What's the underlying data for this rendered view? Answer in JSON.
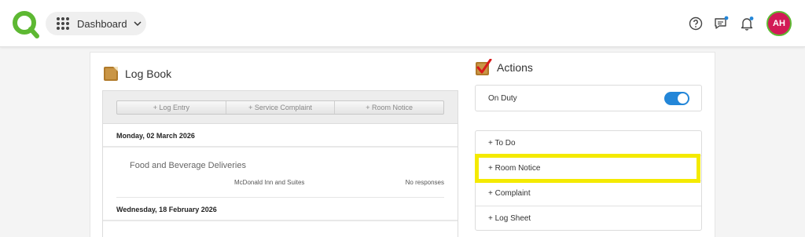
{
  "topbar": {
    "dashboard_label": "Dashboard",
    "avatar_initials": "AH",
    "icons": [
      "app-grid-icon",
      "chevron-down-icon",
      "help-icon",
      "chat-icon",
      "bell-icon"
    ],
    "colors": {
      "logo": "#5db832",
      "avatar_bg": "#d21a56",
      "notification_dot": "#2386d8"
    }
  },
  "logbook": {
    "title": "Log Book",
    "toolbar": [
      "+ Log Entry",
      "+ Service Complaint",
      "+ Room Notice"
    ],
    "days": [
      {
        "date": "Monday, 02 March 2026",
        "entries": [
          {
            "title": "Food and Beverage Deliveries",
            "location": "McDonald Inn and Suites",
            "responses": "No responses"
          }
        ]
      },
      {
        "date": "Wednesday, 18 February 2026",
        "entries": []
      }
    ]
  },
  "actions": {
    "title": "Actions",
    "on_duty_label": "On Duty",
    "on_duty": true,
    "items": [
      "+ To Do",
      "+ Room Notice",
      "+ Complaint",
      "+ Log Sheet"
    ],
    "highlight_color": "#f4ea00",
    "toggle_color": "#2386d8"
  }
}
